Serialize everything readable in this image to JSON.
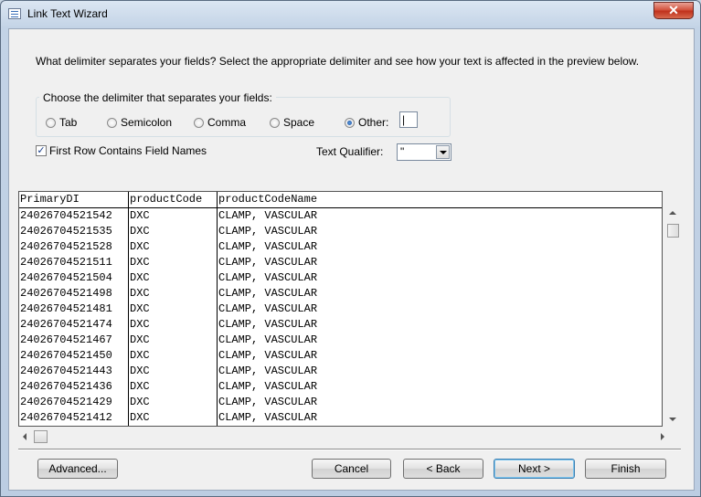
{
  "window": {
    "title": "Link Text Wizard",
    "close_glyph": "✕"
  },
  "instruction": "What delimiter separates your fields? Select the appropriate delimiter and see how your text is affected in the preview below.",
  "delimiter_group": {
    "label": "Choose the delimiter that separates your fields:",
    "options": [
      {
        "label": "Tab",
        "checked": false
      },
      {
        "label": "Semicolon",
        "checked": false
      },
      {
        "label": "Comma",
        "checked": false
      },
      {
        "label": "Space",
        "checked": false
      },
      {
        "label": "Other:",
        "checked": true
      }
    ],
    "other_value": "|"
  },
  "first_row_names": {
    "label": "First Row Contains Field Names",
    "checked": true,
    "check_glyph": "✓"
  },
  "text_qualifier": {
    "label": "Text Qualifier:",
    "value": "\""
  },
  "preview": {
    "headers": [
      "PrimaryDI",
      "productCode",
      "productCodeName"
    ],
    "rows": [
      [
        "24026704521542",
        "DXC",
        "CLAMP, VASCULAR"
      ],
      [
        "24026704521535",
        "DXC",
        "CLAMP, VASCULAR"
      ],
      [
        "24026704521528",
        "DXC",
        "CLAMP, VASCULAR"
      ],
      [
        "24026704521511",
        "DXC",
        "CLAMP, VASCULAR"
      ],
      [
        "24026704521504",
        "DXC",
        "CLAMP, VASCULAR"
      ],
      [
        "24026704521498",
        "DXC",
        "CLAMP, VASCULAR"
      ],
      [
        "24026704521481",
        "DXC",
        "CLAMP, VASCULAR"
      ],
      [
        "24026704521474",
        "DXC",
        "CLAMP, VASCULAR"
      ],
      [
        "24026704521467",
        "DXC",
        "CLAMP, VASCULAR"
      ],
      [
        "24026704521450",
        "DXC",
        "CLAMP, VASCULAR"
      ],
      [
        "24026704521443",
        "DXC",
        "CLAMP, VASCULAR"
      ],
      [
        "24026704521436",
        "DXC",
        "CLAMP, VASCULAR"
      ],
      [
        "24026704521429",
        "DXC",
        "CLAMP, VASCULAR"
      ],
      [
        "24026704521412",
        "DXC",
        "CLAMP, VASCULAR"
      ]
    ]
  },
  "buttons": {
    "advanced": "Advanced...",
    "cancel": "Cancel",
    "back": "< Back",
    "next": "Next >",
    "finish": "Finish"
  }
}
